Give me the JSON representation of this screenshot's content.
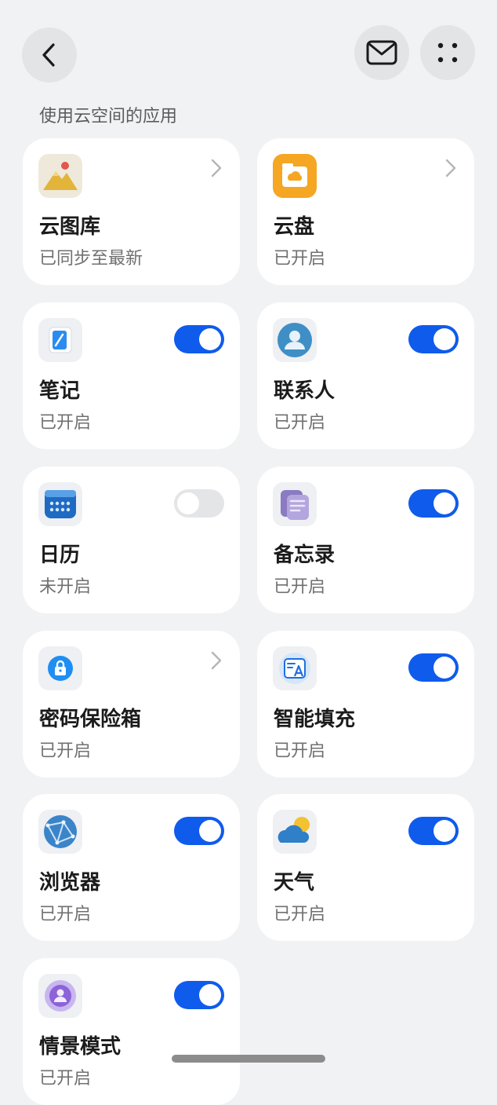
{
  "header": {
    "back_icon": "chevron-left-icon",
    "mail_icon": "mail-icon",
    "more_icon": "four-dots-icon"
  },
  "section": {
    "title": "使用云空间的应用"
  },
  "apps": [
    {
      "name": "云图库",
      "status": "已同步至最新",
      "control": "chevron",
      "icon": "gallery-icon"
    },
    {
      "name": "云盘",
      "status": "已开启",
      "control": "chevron",
      "icon": "cloud-drive-icon",
      "accent": "#f5a623"
    },
    {
      "name": "笔记",
      "status": "已开启",
      "control": "toggle",
      "enabled": true,
      "icon": "notes-icon"
    },
    {
      "name": "联系人",
      "status": "已开启",
      "control": "toggle",
      "enabled": true,
      "icon": "contacts-icon"
    },
    {
      "name": "日历",
      "status": "未开启",
      "control": "toggle",
      "enabled": false,
      "icon": "calendar-icon"
    },
    {
      "name": "备忘录",
      "status": "已开启",
      "control": "toggle",
      "enabled": true,
      "icon": "memo-icon"
    },
    {
      "name": "密码保险箱",
      "status": "已开启",
      "control": "chevron",
      "icon": "password-vault-icon"
    },
    {
      "name": "智能填充",
      "status": "已开启",
      "control": "toggle",
      "enabled": true,
      "icon": "smart-fill-icon"
    },
    {
      "name": "浏览器",
      "status": "已开启",
      "control": "toggle",
      "enabled": true,
      "icon": "browser-icon"
    },
    {
      "name": "天气",
      "status": "已开启",
      "control": "toggle",
      "enabled": true,
      "icon": "weather-icon"
    },
    {
      "name": "情景模式",
      "status": "已开启",
      "control": "toggle",
      "enabled": true,
      "icon": "scene-mode-icon"
    }
  ],
  "colors": {
    "toggle_on": "#0f5bec",
    "toggle_off": "#e4e5e7",
    "background": "#f1f2f4"
  }
}
